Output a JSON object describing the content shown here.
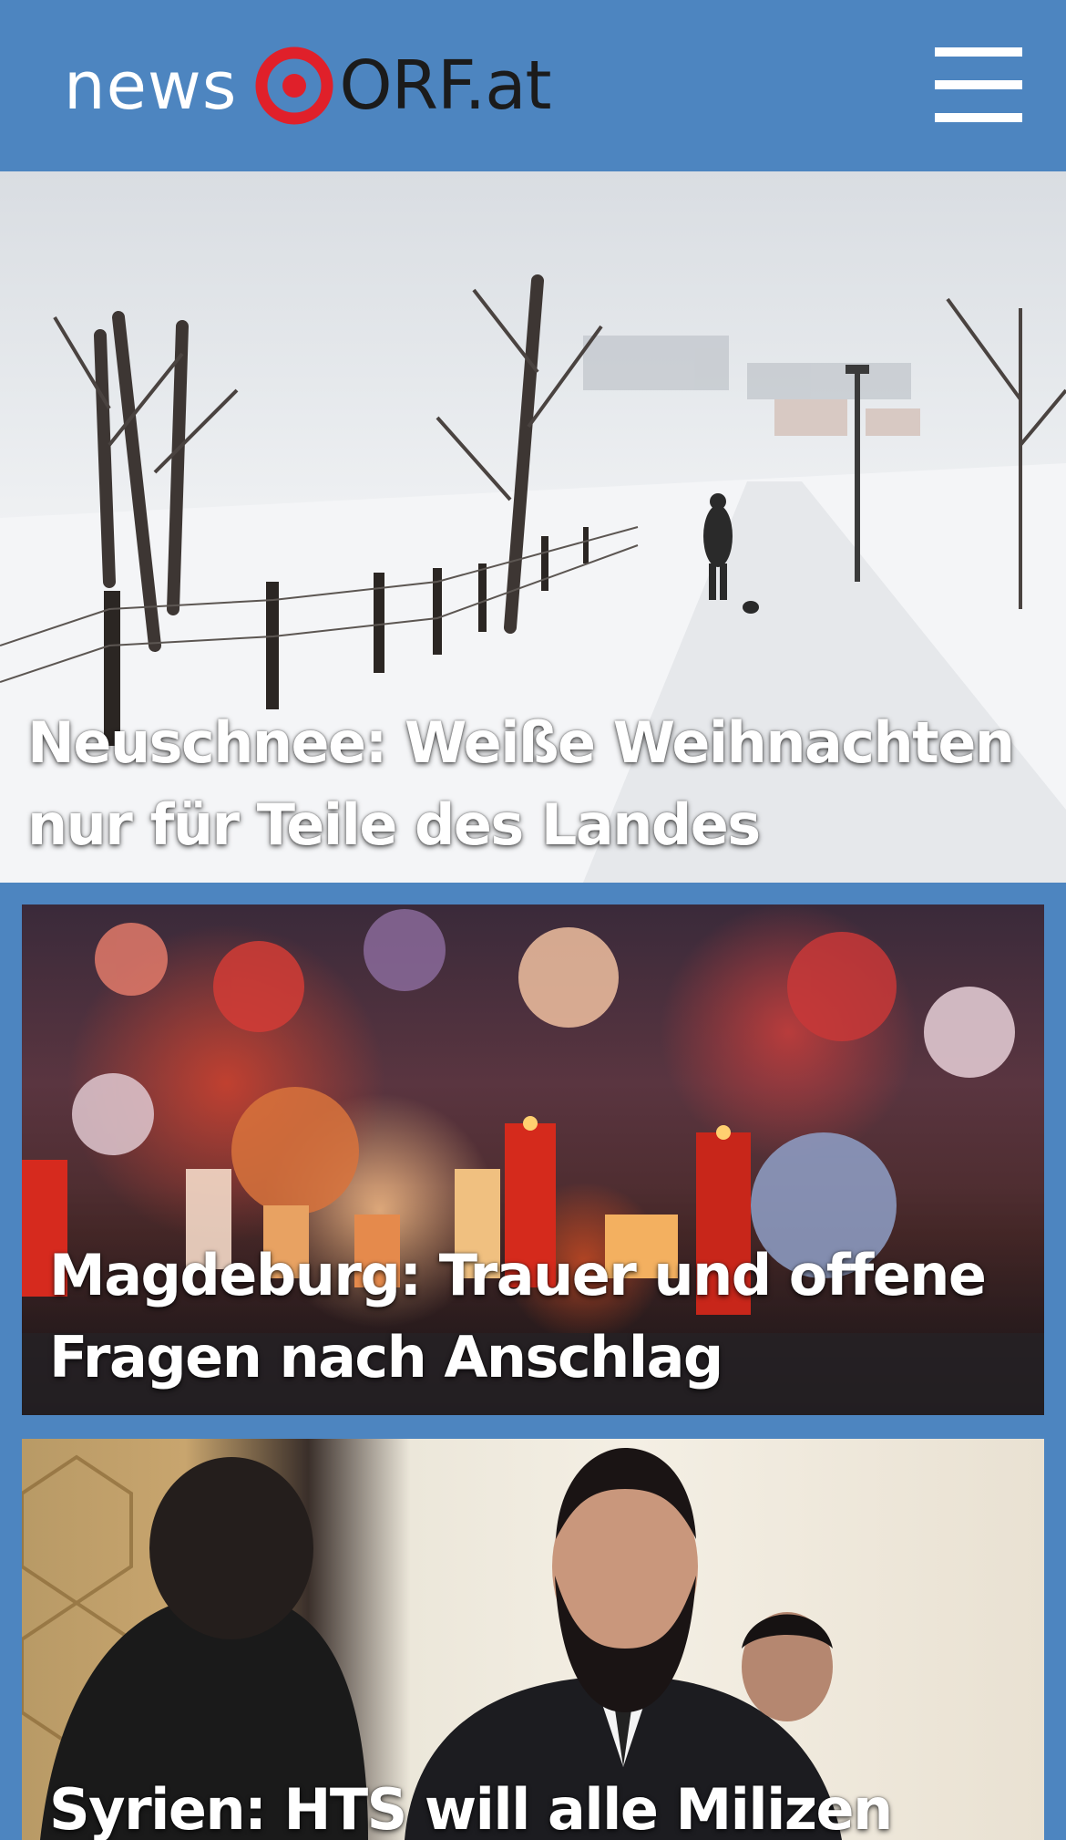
{
  "header": {
    "logo_news": "news",
    "logo_orf": "ORF.at",
    "brand_color": "#4d85c0",
    "logo_mark_color": "#e0202a",
    "menu_icon": "hamburger-menu-icon"
  },
  "stories": [
    {
      "headline": "Neuschnee: Weiße Weihnachten nur für Teile des Landes",
      "image": "snowy-landscape-photo"
    },
    {
      "headline": "Magdeburg: Trauer und offene Fragen nach Anschlag",
      "image": "memorial-flowers-candles-photo"
    },
    {
      "headline": "Syrien: HTS will alle Milizen",
      "image": "syria-leader-photo"
    }
  ]
}
